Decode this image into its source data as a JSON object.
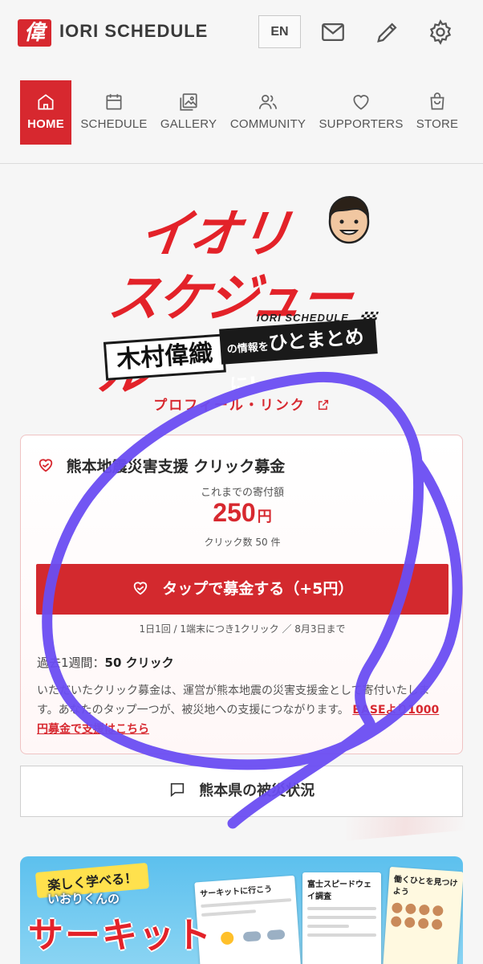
{
  "header": {
    "logo_mark": "偉",
    "site_title": "IORI SCHEDULE",
    "lang_button": "EN",
    "icons": [
      "mail-icon",
      "pencil-icon",
      "gear-icon"
    ]
  },
  "nav": {
    "items": [
      {
        "label": "HOME",
        "icon": "home-icon",
        "active": true
      },
      {
        "label": "SCHEDULE",
        "icon": "calendar-icon",
        "active": false
      },
      {
        "label": "GALLERY",
        "icon": "gallery-icon",
        "active": false
      },
      {
        "label": "COMMUNITY",
        "icon": "people-icon",
        "active": false
      },
      {
        "label": "SUPPORTERS",
        "icon": "heart-icon",
        "active": false
      },
      {
        "label": "STORE",
        "icon": "shopping-bag-icon",
        "active": false
      }
    ]
  },
  "hero": {
    "line1": "イオリ",
    "line2": "スケジュール",
    "sub": "IORI SCHEDULE",
    "band_name": "木村偉織",
    "band_small": "の情報を",
    "band_tail": "ひとまとめに!"
  },
  "profile_link": "プロフィール・リンク",
  "donation": {
    "title": "熊本地震災害支援 クリック募金",
    "total_label": "これまでの寄付額",
    "amount": "250",
    "unit": "円",
    "click_count": "クリック数 50 件",
    "button_label": "タップで募金する（+5円）",
    "note": "1日1回 / 1端末につき1クリック ／ 8月3日まで",
    "week_label": "過去1週間：",
    "week_value": "50 クリック",
    "description": "いただいたクリック募金は、運営が熊本地震の災害支援金として寄付いたします。あなたのタップ一つが、被災地への支援につながります。",
    "link_text": "BASEより1000円募金で支援はこちら"
  },
  "status_button": "熊本県の被災状況",
  "banner": {
    "tag": "楽しく学べる！",
    "sub": "いおりくんの",
    "main": "サーキット",
    "sheet1_title": "サーキットに行こう",
    "sheet2_title": "富士スピードウェイ調査",
    "sheet3_title": "働くひとを見つけよう"
  },
  "colors": {
    "accent": "#d7282f",
    "scribble": "#6a4df2"
  }
}
